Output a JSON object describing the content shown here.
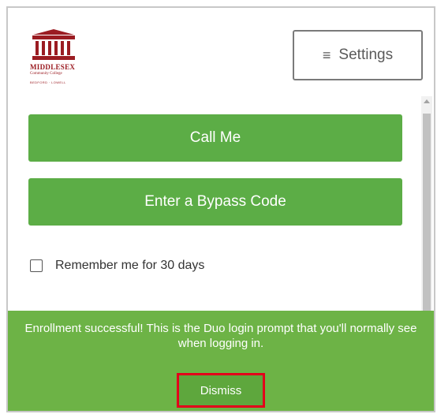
{
  "logo": {
    "line1": "MIDDLESEX",
    "line2": "Community College",
    "line3": "BEDFORD · LOWELL",
    "brand_color": "#9b1c22"
  },
  "header": {
    "settings_label": "Settings",
    "settings_icon": "hamburger-icon"
  },
  "actions": {
    "call_label": "Call Me",
    "bypass_label": "Enter a Bypass Code"
  },
  "remember": {
    "label": "Remember me for 30 days",
    "checked": false
  },
  "banner": {
    "message": "Enrollment successful! This is the Duo login prompt that you'll normally see when logging in.",
    "dismiss_label": "Dismiss",
    "color": "#6db346"
  },
  "colors": {
    "button_green": "#5cad46",
    "highlight_red": "#e3001b"
  }
}
